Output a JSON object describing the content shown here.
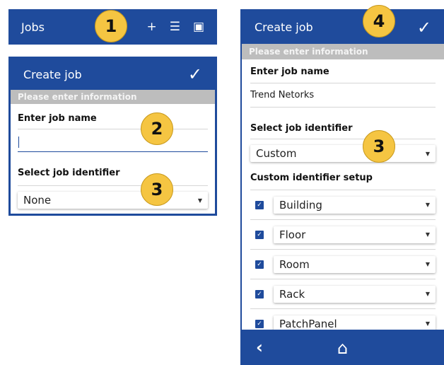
{
  "jobs_bar": {
    "title": "Jobs",
    "add_icon": "+",
    "list_icon": "☰",
    "pdf_icon": "▣"
  },
  "badges": [
    "1",
    "2",
    "3",
    "4",
    "3"
  ],
  "left_panel": {
    "title": "Create job",
    "info": "Please enter information",
    "job_name_label": "Enter job name",
    "job_name_value": "",
    "identifier_label": "Select job identifier",
    "identifier_value": "None"
  },
  "right_panel": {
    "title": "Create job",
    "info": "Please enter information",
    "job_name_label": "Enter job name",
    "job_name_value": "Trend Netorks",
    "identifier_label": "Select job identifier",
    "identifier_value": "Custom",
    "custom_setup_label": "Custom identifier setup",
    "identifiers": [
      {
        "label": "Building",
        "checked": true
      },
      {
        "label": "Floor",
        "checked": true
      },
      {
        "label": "Room",
        "checked": true
      },
      {
        "label": "Rack",
        "checked": true
      },
      {
        "label": "PatchPanel",
        "checked": true
      }
    ]
  },
  "icons": {
    "check": "✓",
    "caret": "▼",
    "back": "‹",
    "home": "⌂"
  },
  "colors": {
    "primary": "#1f4b9c",
    "badge": "#f5c542",
    "info_bar": "#bdbdbd"
  }
}
